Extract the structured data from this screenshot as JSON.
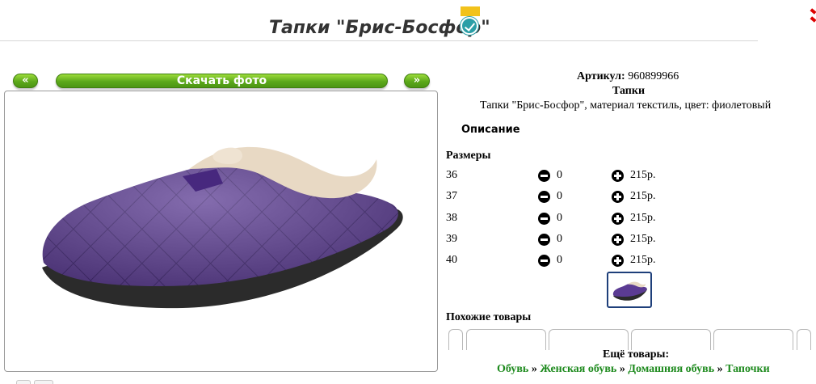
{
  "header": {
    "title": "Тапки \"Брис-Босфор\"",
    "favorite_icon": "bookmark-check-icon",
    "accent_color": "#2a9fa7"
  },
  "gallery": {
    "prev_label": "«",
    "download_label": "Скачать фото",
    "next_label": "»",
    "button_color": "#5ca81b"
  },
  "product": {
    "article_label": "Артикул:",
    "article_value": "960899966",
    "type": "Тапки",
    "description": "Тапки \"Брис-Босфор\", материал текстиль, цвет: фиолетовый",
    "description_heading": "Описание",
    "sizes_heading": "Размеры",
    "sizes": [
      {
        "size": "36",
        "qty": "0",
        "price": "215р."
      },
      {
        "size": "37",
        "qty": "0",
        "price": "215р."
      },
      {
        "size": "38",
        "qty": "0",
        "price": "215р."
      },
      {
        "size": "39",
        "qty": "0",
        "price": "215р."
      },
      {
        "size": "40",
        "qty": "0",
        "price": "215р."
      }
    ]
  },
  "similar": {
    "heading": "Похожие товары"
  },
  "more": {
    "heading": "Ещё товары:",
    "breadcrumbs": [
      "Обувь",
      "Женская обувь",
      "Домашняя обувь",
      "Тапочки"
    ],
    "separator": "»",
    "link_color": "#1d8a1d"
  }
}
